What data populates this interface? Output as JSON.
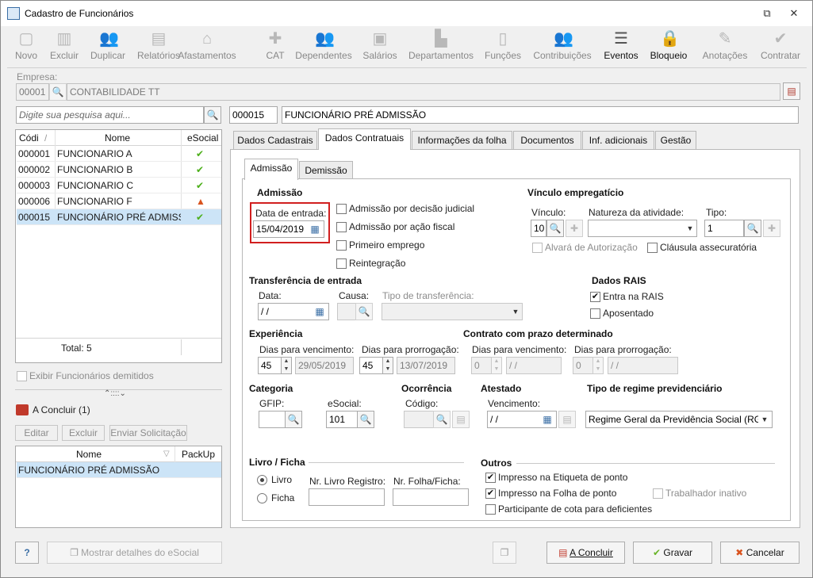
{
  "window": {
    "title": "Cadastro de Funcionários",
    "minimize_glyph": "⧉",
    "close_glyph": "✕"
  },
  "toolbar": [
    {
      "label": "Novo",
      "icon": "new-doc-icon",
      "glyph": "▢",
      "active": false
    },
    {
      "label": "Excluir",
      "icon": "trash-icon",
      "glyph": "▥",
      "active": false
    },
    {
      "label": "Duplicar",
      "icon": "users-icon",
      "glyph": "👥",
      "active": false
    },
    {
      "label": "Relatórios",
      "icon": "report-icon",
      "glyph": "▤",
      "active": false
    },
    {
      "label": "Afastamentos",
      "icon": "house-icon",
      "glyph": "⌂",
      "active": false
    },
    {
      "label": "CAT",
      "icon": "medical-cross-icon",
      "glyph": "✚",
      "active": false
    },
    {
      "label": "Dependentes",
      "icon": "dependents-icon",
      "glyph": "👥",
      "active": false
    },
    {
      "label": "Salários",
      "icon": "salary-icon",
      "glyph": "▣",
      "active": false
    },
    {
      "label": "Departamentos",
      "icon": "desk-icon",
      "glyph": "▙",
      "active": false
    },
    {
      "label": "Funções",
      "icon": "badge-icon",
      "glyph": "▯",
      "active": false
    },
    {
      "label": "Contribuições",
      "icon": "contributions-icon",
      "glyph": "👥",
      "active": false
    },
    {
      "label": "Eventos",
      "icon": "list-icon",
      "glyph": "☰",
      "active": true
    },
    {
      "label": "Bloqueio",
      "icon": "lock-icon",
      "glyph": "🔒",
      "active": true
    },
    {
      "label": "Anotações",
      "icon": "notes-icon",
      "glyph": "✎",
      "active": false
    },
    {
      "label": "Contratar",
      "icon": "contract-icon",
      "glyph": "✔",
      "active": false
    }
  ],
  "empresa": {
    "label": "Empresa:",
    "code": "00001",
    "name": "CONTABILIDADE TT"
  },
  "search": {
    "placeholder": "Digite sua pesquisa aqui..."
  },
  "employee_header": {
    "code": "000015",
    "name": "FUNCIONÁRIO PRÉ ADMISSÃO"
  },
  "employee_grid": {
    "columns": [
      "Códi",
      "Nome",
      "eSocial"
    ],
    "rows": [
      {
        "code": "000001",
        "name": "FUNCIONARIO A",
        "status": "ok"
      },
      {
        "code": "000002",
        "name": "FUNCIONARIO B",
        "status": "ok"
      },
      {
        "code": "000003",
        "name": "FUNCIONARIO C",
        "status": "ok"
      },
      {
        "code": "000006",
        "name": "FUNCIONARIO F",
        "status": "warning"
      },
      {
        "code": "000015",
        "name": "FUNCIONÁRIO PRÉ ADMISSÃ",
        "status": "ok"
      }
    ],
    "total": "Total: 5",
    "ok_glyph": "✔",
    "warning_glyph": "▲",
    "sort_glyph": "/"
  },
  "show_dismissed": "Exibir Funcionários demitidos",
  "splitter_glyph": "⌃::::⌄",
  "pending": {
    "title": "A Concluir (1)",
    "buttons": [
      "Editar",
      "Excluir",
      "Enviar Solicitação"
    ],
    "columns": [
      "Nome",
      "PackUp"
    ],
    "rows": [
      {
        "name": "FUNCIONÁRIO PRÉ ADMISSÃO",
        "packup": ""
      }
    ],
    "sort_glyph": "▽"
  },
  "tabs": [
    "Dados Cadastrais",
    "Dados Contratuais",
    "Informações da folha",
    "Documentos",
    "Inf. adicionais",
    "Gestão"
  ],
  "subtabs": [
    "Admissão",
    "Demissão"
  ],
  "admissao": {
    "title": "Admissão",
    "data_entrada_label": "Data de entrada:",
    "data_entrada": "15/04/2019",
    "judicial": "Admissão por decisão judicial",
    "fiscal": "Admissão por ação fiscal",
    "primeiro": "Primeiro emprego",
    "reintegracao": "Reintegração"
  },
  "vinculo": {
    "title": "Vínculo empregatício",
    "vinculo_label": "Vínculo:",
    "vinculo_value": "10",
    "natureza_label": "Natureza da atividade:",
    "natureza_value": "",
    "tipo_label": "Tipo:",
    "tipo_value": "1",
    "alvara": "Alvará de Autorização",
    "clausula": "Cláusula assecuratória"
  },
  "transferencia": {
    "title": "Transferência de entrada",
    "data_label": "Data:",
    "data_value": " /  /",
    "causa_label": "Causa:",
    "tipo_label": "Tipo de transferência:"
  },
  "rais": {
    "title": "Dados RAIS",
    "entra": "Entra na RAIS",
    "entra_checked": true,
    "aposentado": "Aposentado"
  },
  "experiencia": {
    "title": "Experiência",
    "venc_label": "Dias para vencimento:",
    "venc_days": "45",
    "venc_date": "29/05/2019",
    "prorr_label": "Dias para prorrogação:",
    "prorr_days": "45",
    "prorr_date": "13/07/2019"
  },
  "contrato": {
    "title": "Contrato com prazo determinado",
    "venc_label": "Dias para vencimento:",
    "venc_days": "0",
    "venc_date": " /  /",
    "prorr_label": "Dias para prorrogação:",
    "prorr_days": "0",
    "prorr_date": " /  /"
  },
  "categoria": {
    "title": "Categoria",
    "gfip_label": "GFIP:",
    "gfip_value": "",
    "esocial_label": "eSocial:",
    "esocial_value": "101"
  },
  "ocorrencia": {
    "title": "Ocorrência",
    "codigo_label": "Código:",
    "codigo_value": ""
  },
  "atestado": {
    "title": "Atestado",
    "venc_label": "Vencimento:",
    "venc_value": " /  /"
  },
  "regime": {
    "title": "Tipo de regime previdenciário",
    "value": "Regime Geral da Previdência Social (RGP"
  },
  "livro": {
    "title": "Livro / Ficha",
    "livro_option": "Livro",
    "ficha_option": "Ficha",
    "nr_livro_label": "Nr. Livro Registro:",
    "nr_folha_label": "Nr. Folha/Ficha:"
  },
  "outros": {
    "title": "Outros",
    "etiqueta": "Impresso na Etiqueta de ponto",
    "folha": "Impresso na Folha de ponto",
    "inativo": "Trabalhador inativo",
    "cota": "Participante de cota para deficientes"
  },
  "footer": {
    "help": "?",
    "detalhes": "Mostrar detalhes do eSocial",
    "concluir": "A Concluir",
    "gravar": "Gravar",
    "cancelar": "Cancelar"
  },
  "glyphs": {
    "search": "🔍",
    "calendar": "▦",
    "dropdown": "▼",
    "check": "✔",
    "spin_up": "▲",
    "spin_down": "▼",
    "add": "✚",
    "grid": "▤",
    "copy": "❐",
    "x": "✖"
  },
  "colors": {
    "ok": "#4caf1a",
    "warning": "#d9531e",
    "highlight": "#d11f1f",
    "selection": "#cce4f7"
  }
}
